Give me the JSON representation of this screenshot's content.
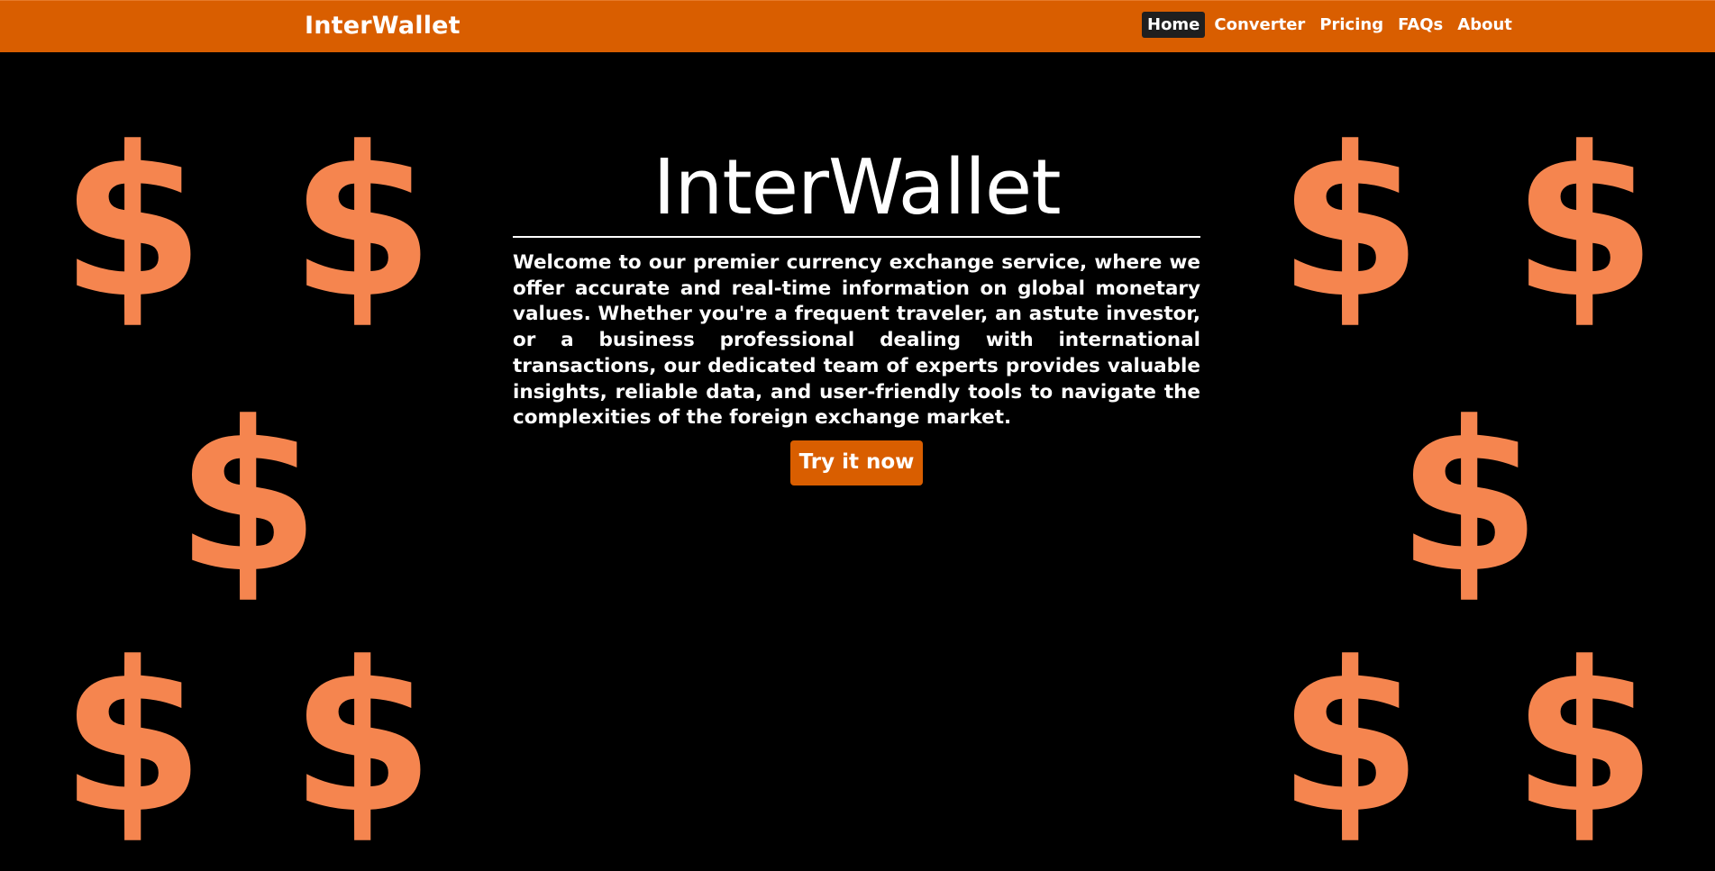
{
  "navbar": {
    "brand": "InterWallet",
    "items": [
      {
        "label": "Home",
        "active": true
      },
      {
        "label": "Converter",
        "active": false
      },
      {
        "label": "Pricing",
        "active": false
      },
      {
        "label": "FAQs",
        "active": false
      },
      {
        "label": "About",
        "active": false
      }
    ],
    "bg_color": "#d95e00",
    "active_bg_color": "#1f1f1f"
  },
  "decor": {
    "symbol": "$",
    "color": "#f5854f",
    "count": 10
  },
  "hero": {
    "title": "InterWallet",
    "description": "Welcome to our premier currency exchange service, where we offer accurate and real-time information on global monetary values. Whether you're a frequent traveler, an astute investor, or a business professional dealing with international transactions, our dedicated team of experts provides valuable insights, reliable data, and user-friendly tools to navigate the complexities of the foreign exchange market.",
    "cta_label": "Try it now"
  },
  "page": {
    "background": "#000000"
  }
}
